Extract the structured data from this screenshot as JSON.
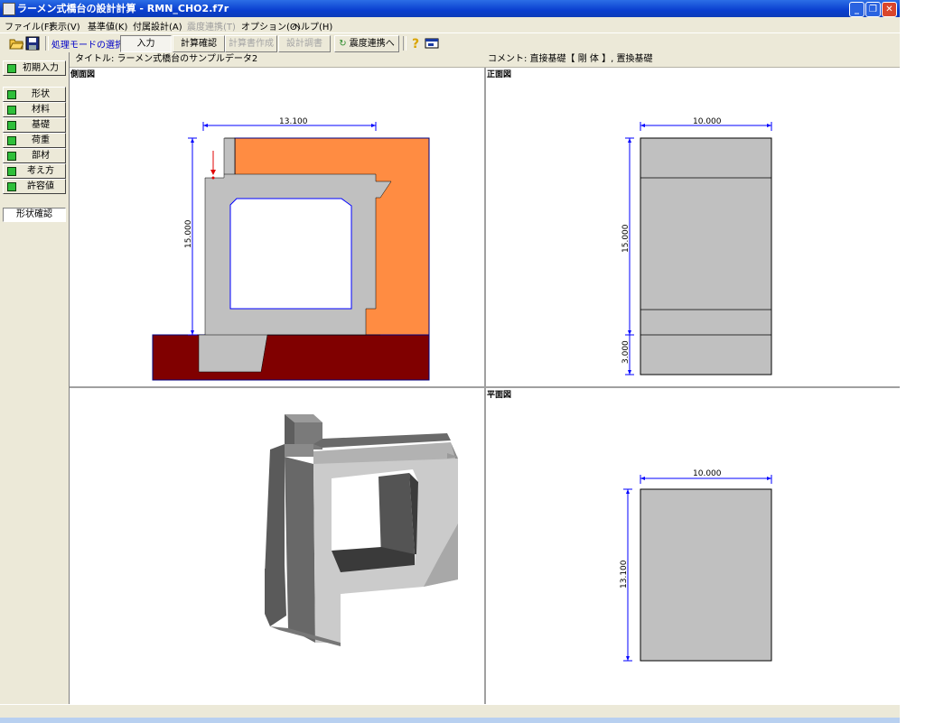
{
  "window": {
    "title": "ラーメン式橋台の設計計算 - RMN_CHO2.f7r"
  },
  "menu": [
    {
      "label": "ファイル(F)",
      "enabled": true
    },
    {
      "label": "表示(V)",
      "enabled": true
    },
    {
      "label": "基準値(K)",
      "enabled": true
    },
    {
      "label": "付属設計(A)",
      "enabled": true
    },
    {
      "label": "震度連携(T)",
      "enabled": false
    },
    {
      "label": "オプション(O)",
      "enabled": true
    },
    {
      "label": "ヘルプ(H)",
      "enabled": true
    }
  ],
  "toolbar": {
    "mode_label": "処理モードの選択",
    "input_label": "入力",
    "calc_check_label": "計算確認",
    "report_label": "計算書作成",
    "design_doc_label": "設計調書",
    "seismic_label": "震度連携へ"
  },
  "left_nav": {
    "initial_input": "初期入力",
    "items": [
      {
        "label": "形状"
      },
      {
        "label": "材料"
      },
      {
        "label": "基礎"
      },
      {
        "label": "荷重"
      },
      {
        "label": "部材"
      },
      {
        "label": "考え方"
      },
      {
        "label": "許容値"
      }
    ],
    "shape_check": "形状確認"
  },
  "info": {
    "title": "タイトル: ラーメン式橋台のサンプルデータ2",
    "comment": "コメント: 直接基礎【 剛 体 】, 置換基礎"
  },
  "views": {
    "side": {
      "label": "側面図",
      "dim_width": "13.100",
      "dim_height": "15.000"
    },
    "front": {
      "label": "正面図",
      "dim_width": "10.000",
      "dim_height": "15.000",
      "dim_base": "3.000"
    },
    "plan": {
      "label": "平面図",
      "dim_width": "10.000",
      "dim_height": "13.100"
    }
  },
  "colors": {
    "backfill": "#ff8c42",
    "ground": "#800000",
    "concrete": "#c0c0c0",
    "dimension": "#0000ff"
  }
}
